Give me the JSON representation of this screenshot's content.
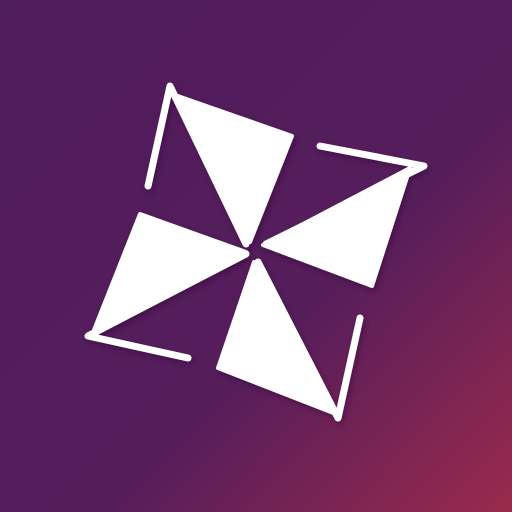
{
  "icon": {
    "name": "pinwheel-logo-icon",
    "background": {
      "gradient_start": "#4F1C5C",
      "gradient_mid": "#561D5B",
      "gradient_end": "#9A2A4C"
    },
    "foreground_color": "#FFFFFF",
    "shadow_color": "#2A0B33"
  }
}
